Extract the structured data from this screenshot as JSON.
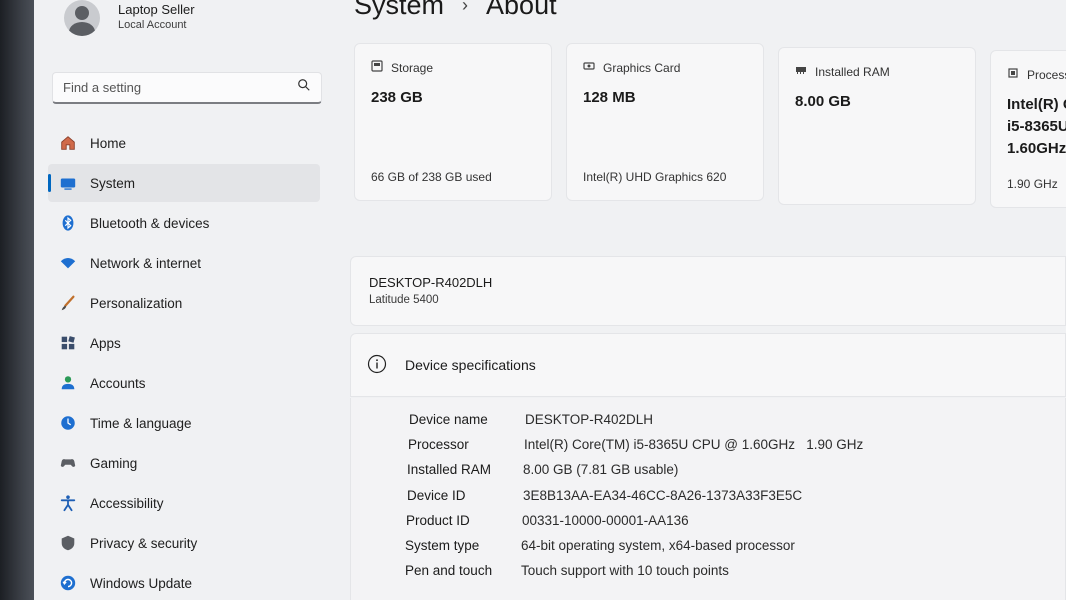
{
  "profile": {
    "name": "Laptop Seller",
    "account_type": "Local Account"
  },
  "search": {
    "placeholder": "Find a setting"
  },
  "nav": [
    {
      "label": "Home",
      "icon": "home-icon"
    },
    {
      "label": "System",
      "icon": "system-icon",
      "active": true
    },
    {
      "label": "Bluetooth & devices",
      "icon": "bluetooth-icon"
    },
    {
      "label": "Network & internet",
      "icon": "wifi-icon"
    },
    {
      "label": "Personalization",
      "icon": "brush-icon"
    },
    {
      "label": "Apps",
      "icon": "apps-icon"
    },
    {
      "label": "Accounts",
      "icon": "accounts-icon"
    },
    {
      "label": "Time & language",
      "icon": "globe-clock-icon"
    },
    {
      "label": "Gaming",
      "icon": "gamepad-icon"
    },
    {
      "label": "Accessibility",
      "icon": "accessibility-icon"
    },
    {
      "label": "Privacy & security",
      "icon": "shield-icon"
    },
    {
      "label": "Windows Update",
      "icon": "update-icon"
    }
  ],
  "breadcrumb": {
    "parent": "System",
    "separator": "›",
    "current": "About"
  },
  "cards": {
    "storage": {
      "title": "Storage",
      "value": "238 GB",
      "detail": "66 GB of 238 GB used"
    },
    "graphics": {
      "title": "Graphics Card",
      "value": "128 MB",
      "detail": "Intel(R) UHD Graphics 620"
    },
    "ram": {
      "title": "Installed RAM",
      "value": "8.00 GB"
    },
    "processor": {
      "title": "Processor",
      "value_lines": [
        "Intel(R) C",
        "i5-8365U",
        "1.60GHz"
      ],
      "detail": "1.90 GHz"
    }
  },
  "device": {
    "name": "DESKTOP-R402DLH",
    "model": "Latitude 5400"
  },
  "specs": {
    "title": "Device specifications",
    "rows": [
      {
        "label": "Device name",
        "value": "DESKTOP-R402DLH"
      },
      {
        "label": "Processor",
        "value": "Intel(R) Core(TM) i5-8365U CPU @ 1.60GHz   1.90 GHz"
      },
      {
        "label": "Installed RAM",
        "value": "8.00 GB (7.81 GB usable)"
      },
      {
        "label": "Device ID",
        "value": "3E8B13AA-EA34-46CC-8A26-1373A33F3E5C"
      },
      {
        "label": "Product ID",
        "value": "00331-10000-00001-AA136"
      },
      {
        "label": "System type",
        "value": "64-bit operating system, x64-based processor"
      },
      {
        "label": "Pen and touch",
        "value": "Touch support with 10 touch points"
      }
    ]
  },
  "colors": {
    "accent": "#0067c0",
    "window_bg": "#f0f1f3",
    "card_bg": "#f7f7f8"
  }
}
